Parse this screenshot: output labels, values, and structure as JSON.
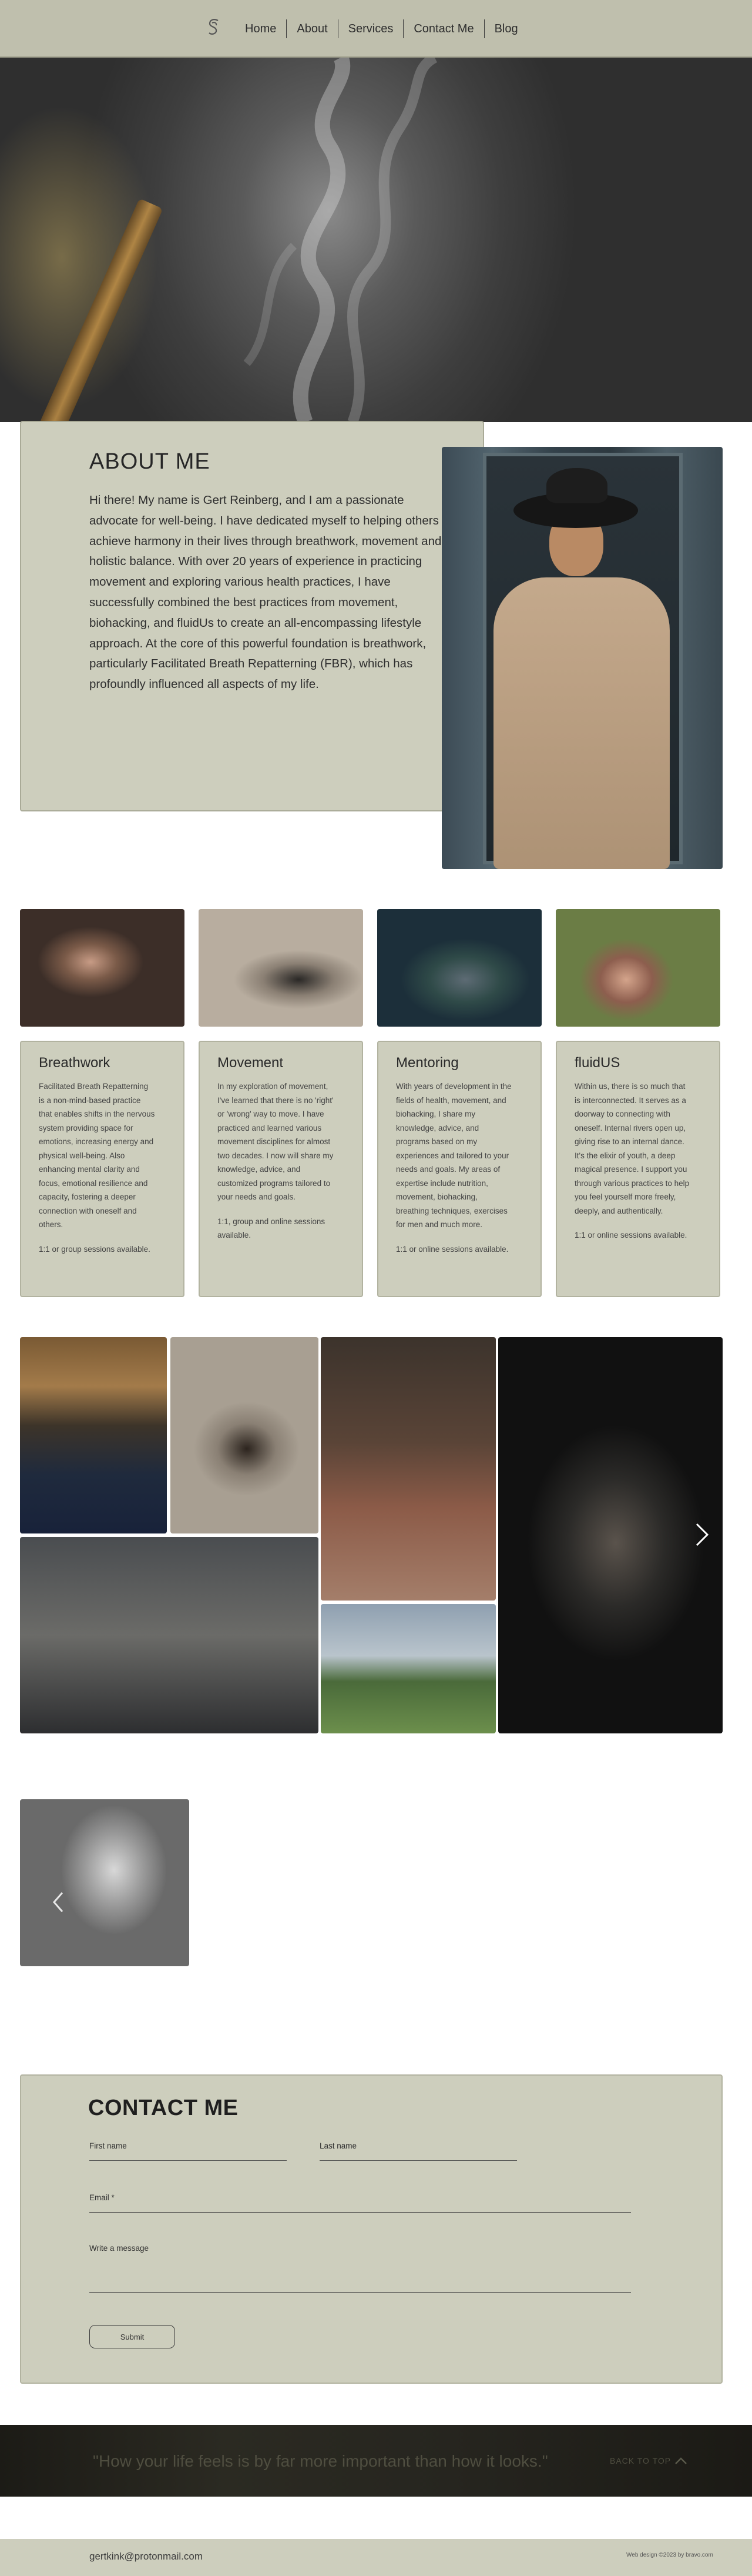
{
  "nav": {
    "items": [
      "Home",
      "About",
      "Services",
      "Contact Me",
      "Blog"
    ]
  },
  "about": {
    "title": "ABOUT ME",
    "text": "Hi there! My name is Gert Reinberg, and I am a passionate advocate for well-being. I have dedicated myself to helping others achieve harmony in their lives through breathwork, movement and, holistic balance. With over 20 years of experience in practicing movement and exploring various health practices, I have successfully combined the best practices from movement, biohacking, and fluidUs to create an all-encompassing lifestyle approach. At the core of this powerful foundation is breathwork, particularly Facilitated Breath Repatterning (FBR), which has profoundly influenced all aspects of my life."
  },
  "services": [
    {
      "title": "Breathwork",
      "description": "Facilitated Breath Repatterning\nis a non-mind-based practice\nthat enables shifts in the nervous\nsystem providing space for\nemotions, increasing energy and\nphysical well-being. Also\nenhancing mental clarity and\nfocus, emotional resilience and\ncapacity, fostering a deeper\nconnection with oneself and\nothers.",
      "extra": "1:1 or group sessions available."
    },
    {
      "title": "Movement",
      "description": "In my exploration of movement,\nI've learned that there is no 'right'\nor 'wrong' way to move. I have\npracticed and learned various\nmovement disciplines for almost\ntwo decades. I now will share my\nknowledge, advice, and\ncustomized programs tailored to\nyour needs and goals.",
      "extra": "1:1, group and online sessions\navailable."
    },
    {
      "title": "Mentoring",
      "description": "With years of development in the\nfields of health, movement, and\nbiohacking, I share my\nknowledge, advice, and\nprograms based on my\nexperiences and tailored to your\nneeds and goals. My areas of\nexpertise include nutrition,\nmovement, biohacking,\nbreathing techniques, exercises\nfor men and much more.",
      "extra": "1:1 or online sessions available."
    },
    {
      "title": "fluidUS",
      "description": "Within us, there is so much that\nis interconnected. It serves as a\ndoorway to connecting with\noneself. Internal rivers open up,\ngiving rise to an internal dance.\nIt's the elixir of youth, a deep\nmagical presence. I support you\nthrough various practices to help\nyou feel yourself more freely,\ndeeply, and authentically.",
      "extra": "1:1 or online sessions available."
    }
  ],
  "contact": {
    "title": "CONTACT ME",
    "first_name_label": "First name",
    "last_name_label": "Last name",
    "email_label": "Email *",
    "message_label": "Write a message",
    "submit_label": "Submit"
  },
  "quote": {
    "text": "\"How your life feels is by far more important than how it looks.\"",
    "back_to_top": "BACK TO TOP"
  },
  "footer": {
    "email": "gertkink@protonmail.com",
    "credit": "Web design ©2023 by bravo.com"
  },
  "colors": {
    "card_bg": "#cdcebd",
    "header_bg": "#bfbfad",
    "quote_bg": "#26251f"
  }
}
